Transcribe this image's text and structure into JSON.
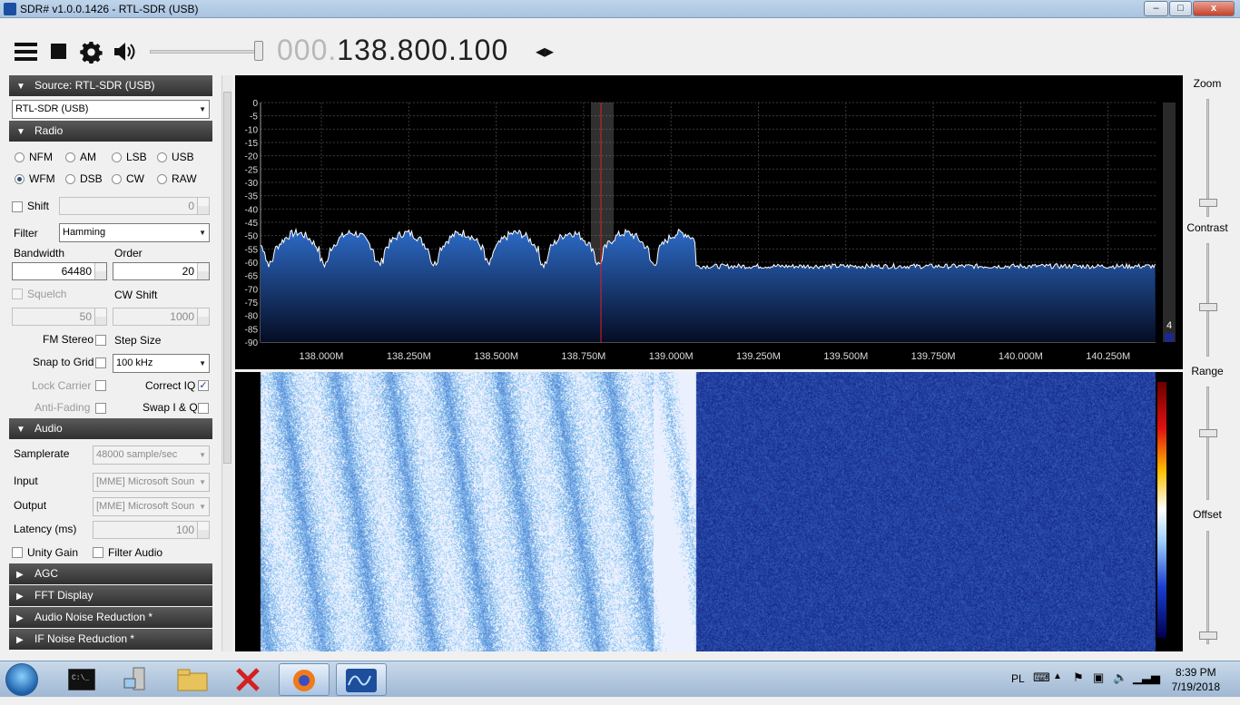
{
  "window": {
    "title": "SDR# v1.0.0.1426 - RTL-SDR (USB)",
    "minimize": "–",
    "maximize": "□",
    "close": "x"
  },
  "toolbar": {
    "frequency_dim": "000.",
    "frequency": "138.800.100",
    "frequency_arrows": "◂▸",
    "volume_level": 0.95
  },
  "source": {
    "header": "Source: RTL-SDR (USB)",
    "device": "RTL-SDR (USB)"
  },
  "radio": {
    "header": "Radio",
    "modes": [
      "NFM",
      "AM",
      "LSB",
      "USB",
      "WFM",
      "DSB",
      "CW",
      "RAW"
    ],
    "selected_mode": "WFM",
    "shift_label": "Shift",
    "shift_value": "0",
    "filter_label": "Filter",
    "filter_value": "Hamming",
    "bandwidth_label": "Bandwidth",
    "bandwidth_value": "64480",
    "order_label": "Order",
    "order_value": "20",
    "squelch_label": "Squelch",
    "squelch_value": "50",
    "cwshift_label": "CW Shift",
    "cwshift_value": "1000",
    "fmstereo_label": "FM Stereo",
    "stepsize_label": "Step Size",
    "snap_label": "Snap to Grid",
    "step_value": "100 kHz",
    "lockcarrier_label": "Lock Carrier",
    "correctiq_label": "Correct IQ",
    "correctiq_checked": true,
    "antifading_label": "Anti-Fading",
    "swapiq_label": "Swap I & Q"
  },
  "audio": {
    "header": "Audio",
    "samplerate_label": "Samplerate",
    "samplerate_value": "48000 sample/sec",
    "input_label": "Input",
    "input_value": "[MME] Microsoft Soun",
    "output_label": "Output",
    "output_value": "[MME] Microsoft Soun",
    "latency_label": "Latency (ms)",
    "latency_value": "100",
    "unitygain_label": "Unity Gain",
    "filteraudio_label": "Filter Audio"
  },
  "collapsed_sections": [
    "AGC",
    "FFT Display",
    "Audio Noise Reduction *",
    "IF Noise Reduction *"
  ],
  "spectrum": {
    "db_ticks": [
      "0",
      "-5",
      "-10",
      "-15",
      "-20",
      "-25",
      "-30",
      "-35",
      "-40",
      "-45",
      "-50",
      "-55",
      "-60",
      "-65",
      "-70",
      "-75",
      "-80",
      "-85",
      "-90"
    ],
    "freq_ticks": [
      "138.000M",
      "138.250M",
      "138.500M",
      "138.750M",
      "139.000M",
      "139.250M",
      "139.500M",
      "139.750M",
      "140.000M",
      "140.250M"
    ],
    "scale_value": "4",
    "tuned_freq_mhz": 138.8001,
    "bandwidth_khz": 64.48
  },
  "side_controls": {
    "zoom": "Zoom",
    "contrast": "Contrast",
    "range": "Range",
    "offset": "Offset"
  },
  "taskbar": {
    "language": "PL",
    "time": "8:39 PM",
    "date": "7/19/2018"
  }
}
